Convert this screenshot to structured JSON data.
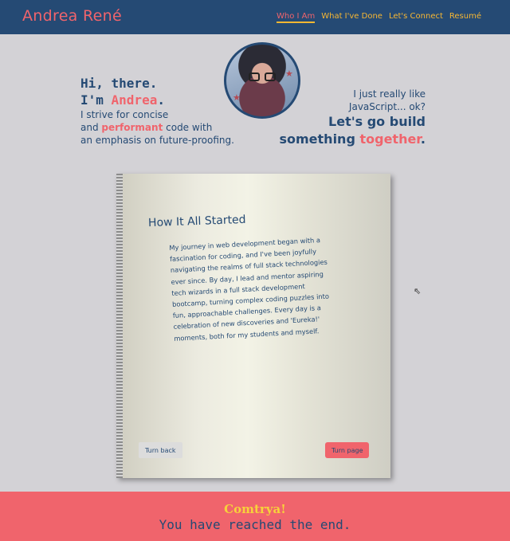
{
  "header": {
    "brand": "Andrea René",
    "nav": [
      "Who I Am",
      "What I've Done",
      "Let's Connect",
      "Resumé"
    ]
  },
  "intro": {
    "line1": "Hi, there.",
    "line2_prefix": "I'm ",
    "line2_name": "Andrea",
    "line2_suffix": ".",
    "line3": "I strive for concise",
    "line4_prefix": "and ",
    "line4_accent": "performant",
    "line4_suffix": " code with",
    "line5": "an emphasis on future-proofing."
  },
  "tagline": {
    "line1": "I just really like",
    "line2": "JavaScript... ok?",
    "line3": "Let's go build",
    "line4_prefix": "something ",
    "line4_accent": "together",
    "line4_suffix": "."
  },
  "book": {
    "title": "How It All Started",
    "text": "My journey in web development began with a fascination for coding, and I've been joyfully navigating the realms of full stack technologies ever since. By day, I lead and mentor aspiring tech wizards in a full stack development bootcamp, turning complex coding puzzles into fun, approachable challenges. Every day is a celebration of new discoveries and 'Eureka!' moments, both for my students and myself.",
    "back_label": "Turn back",
    "next_label": "Turn page"
  },
  "footer": {
    "congrats": "Comtrya!",
    "end": "You have reached the end."
  },
  "colors": {
    "navy": "#254a74",
    "coral": "#f0646c",
    "gold": "#f7b733",
    "background": "#d3d2d6"
  }
}
